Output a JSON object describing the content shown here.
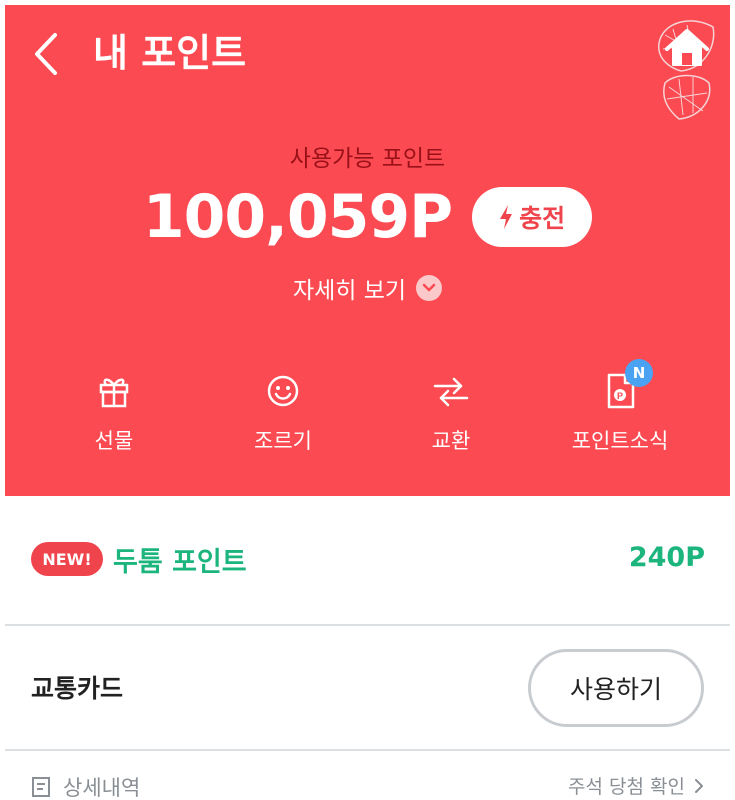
{
  "header": {
    "title": "내 포인트",
    "back_icon": "chevron-left-icon",
    "home_icon": "home-leaf-icon"
  },
  "points": {
    "available_label": "사용가능 포인트",
    "value": "100,059P",
    "charge_label": "충전",
    "charge_icon": "lightning-icon",
    "detail_label": "자세히 보기"
  },
  "actions": [
    {
      "label": "선물",
      "icon": "gift-icon"
    },
    {
      "label": "조르기",
      "icon": "smile-icon"
    },
    {
      "label": "교환",
      "icon": "exchange-arrows-icon"
    },
    {
      "label": "포인트소식",
      "icon": "point-news-icon",
      "badge": "N"
    }
  ],
  "dutum": {
    "badge": "NEW!",
    "label": "두툼 포인트",
    "value": "240P"
  },
  "transit": {
    "label": "교통카드",
    "button_label": "사용하기"
  },
  "bottom": {
    "history_label": "상세내역",
    "draw_label": "주석 당첨 확인"
  },
  "colors": {
    "hero_red": "#fb4a51",
    "accent_green": "#1cb57d",
    "badge_red": "#f0444c",
    "badge_blue": "#4aa3f2",
    "label_dark_red": "#9a1018"
  }
}
